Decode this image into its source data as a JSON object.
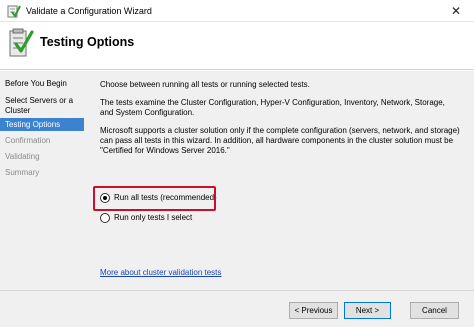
{
  "window": {
    "title": "Validate a Configuration Wizard",
    "close_glyph": "✕"
  },
  "header": {
    "title": "Testing Options",
    "icon": "wizard-checklist-icon"
  },
  "nav": {
    "items": [
      {
        "label": "Before You Begin",
        "state": "normal"
      },
      {
        "label": "Select Servers or a Cluster",
        "state": "normal"
      },
      {
        "label": "Testing Options",
        "state": "active"
      },
      {
        "label": "Confirmation",
        "state": "disabled"
      },
      {
        "label": "Validating",
        "state": "disabled"
      },
      {
        "label": "Summary",
        "state": "disabled"
      }
    ]
  },
  "content": {
    "intro": "Choose between running all tests or running selected tests.",
    "description": "The tests examine the Cluster Configuration, Hyper-V Configuration, Inventory, Network, Storage, and System Configuration.",
    "support_note": "Microsoft supports a cluster solution only if the complete configuration (servers, network, and storage) can pass all tests in this wizard. In addition, all hardware components in the cluster solution must be \"Certified for Windows Server 2016.\"",
    "options": [
      {
        "label": "Run all tests (recommended)",
        "selected": true
      },
      {
        "label": "Run only tests I select",
        "selected": false
      }
    ],
    "more_link": "More about cluster validation tests"
  },
  "buttons": {
    "previous": "< Previous",
    "next": "Next >",
    "cancel": "Cancel"
  },
  "colors": {
    "nav_active": "#3b82d1",
    "highlight_box": "#c8102e",
    "link": "#1a47b8"
  }
}
